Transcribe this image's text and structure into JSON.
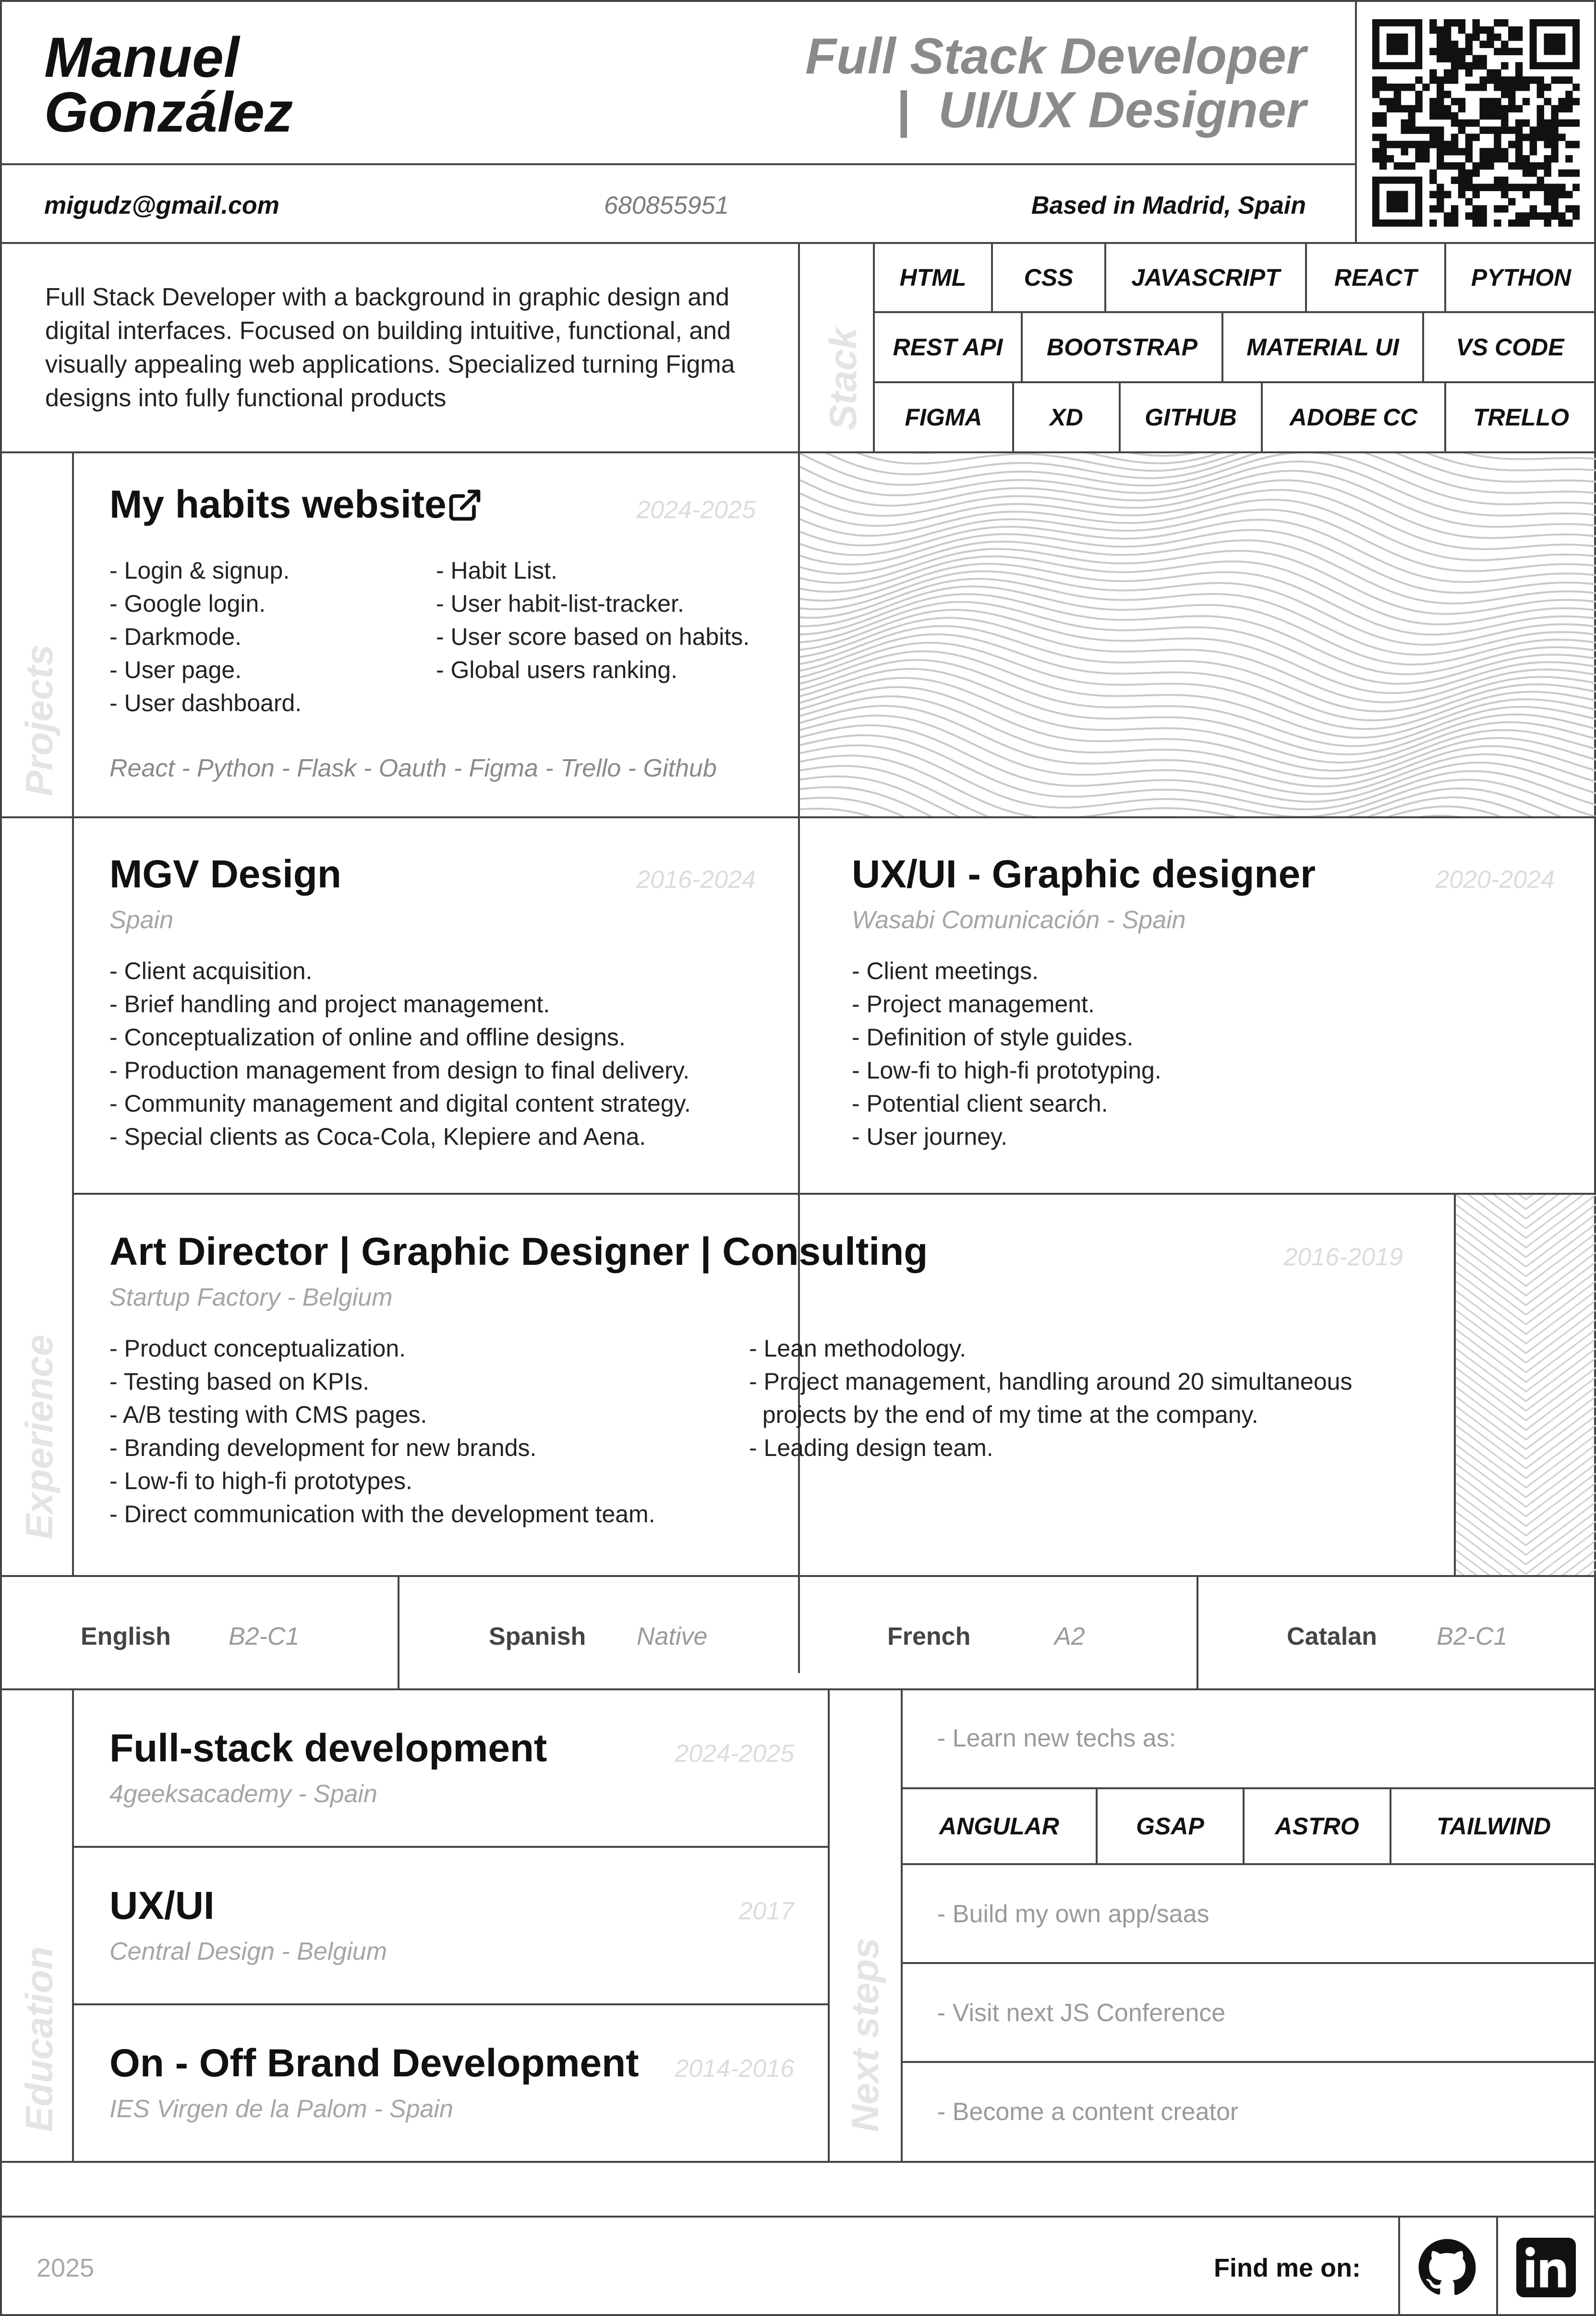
{
  "header": {
    "name_line1": "Manuel",
    "name_line2": "González",
    "role_line1": "Full Stack Developer",
    "role_line2": "|  UI/UX Designer",
    "email": "migudz@gmail.com",
    "phone": "680855951",
    "location": "Based in Madrid, Spain"
  },
  "summary": {
    "lines": [
      "Full Stack Developer with a background in graphic design and",
      "digital interfaces. Focused on building intuitive, functional, and",
      "visually appealing web applications. Specialized turning Figma",
      "designs into fully functional products"
    ]
  },
  "stack": {
    "label": "Stack",
    "row1": [
      "HTML",
      "CSS",
      "JAVASCRIPT",
      "REACT",
      "PYTHON"
    ],
    "row2": [
      "REST API",
      "BOOTSTRAP",
      "MATERIAL UI",
      "VS CODE"
    ],
    "row3": [
      "FIGMA",
      "XD",
      "GITHUB",
      "ADOBE CC",
      "TRELLO"
    ]
  },
  "projects": {
    "label": "Projects",
    "title": "My habits website",
    "link_icon": "external-link-icon",
    "date": "2024-2025",
    "col1": [
      "- Login & signup.",
      "- Google login.",
      "- Darkmode.",
      "- User page.",
      "- User dashboard."
    ],
    "col2": [
      "- Habit List.",
      "- User habit-list-tracker.",
      "- User score based on habits.",
      "- Global users ranking."
    ],
    "tech": "React - Python - Flask - Oauth - Figma - Trello - Github"
  },
  "experience": {
    "label": "Experience",
    "mgv": {
      "title": "MGV Design",
      "date": "2016-2024",
      "location": "Spain",
      "items": [
        "- Client acquisition.",
        "- Brief handling and project management.",
        "- Conceptualization of online and offline designs.",
        "- Production management from design to final delivery.",
        "- Community management and digital content strategy.",
        "- Special clients as Coca-Cola, Klepiere and Aena."
      ]
    },
    "wasabi": {
      "title": "UX/UI - Graphic designer",
      "date": "2020-2024",
      "location": "Wasabi Comunicación - Spain",
      "items": [
        "- Client meetings.",
        "- Project management.",
        "- Definition of style guides.",
        "- Low-fi to high-fi prototyping.",
        "- Potential client search.",
        "- User journey."
      ]
    },
    "startup": {
      "title": "Art Director | Graphic Designer | Consulting",
      "date": "2016-2019",
      "location": "Startup Factory - Belgium",
      "col1": [
        "- Product conceptualization.",
        "- Testing based on KPIs.",
        "- A/B testing with CMS pages.",
        "- Branding development for new brands.",
        "- Low-fi to high-fi prototypes.",
        "- Direct communication with the development team."
      ],
      "col2": [
        "- Lean methodology.",
        "- Project management, handling around 20 simultaneous",
        "  projects by the end of my time at the company.",
        "- Leading design team."
      ]
    }
  },
  "languages": [
    {
      "name": "English",
      "level": "B2-C1"
    },
    {
      "name": "Spanish",
      "level": "Native"
    },
    {
      "name": "French",
      "level": "A2"
    },
    {
      "name": "Catalan",
      "level": "B2-C1"
    }
  ],
  "education": {
    "label": "Education",
    "items": [
      {
        "title": "Full-stack development",
        "date": "2024-2025",
        "location": "4geeksacademy - Spain"
      },
      {
        "title": "UX/UI",
        "date": "2017",
        "location": "Central Design - Belgium"
      },
      {
        "title": "On - Off Brand Development",
        "date": "2014-2016",
        "location": "IES Virgen de la Palom - Spain"
      }
    ]
  },
  "next_steps": {
    "label": "Next steps",
    "learn": "- Learn new techs as:",
    "techs": [
      "ANGULAR",
      "GSAP",
      "ASTRO",
      "TAILWIND"
    ],
    "items": [
      "- Build my own app/saas",
      "- Visit next JS Conference",
      "- Become a content creator"
    ]
  },
  "footer": {
    "year": "2025",
    "find_me": "Find me on:",
    "icons": [
      "github-icon",
      "linkedin-icon"
    ]
  }
}
